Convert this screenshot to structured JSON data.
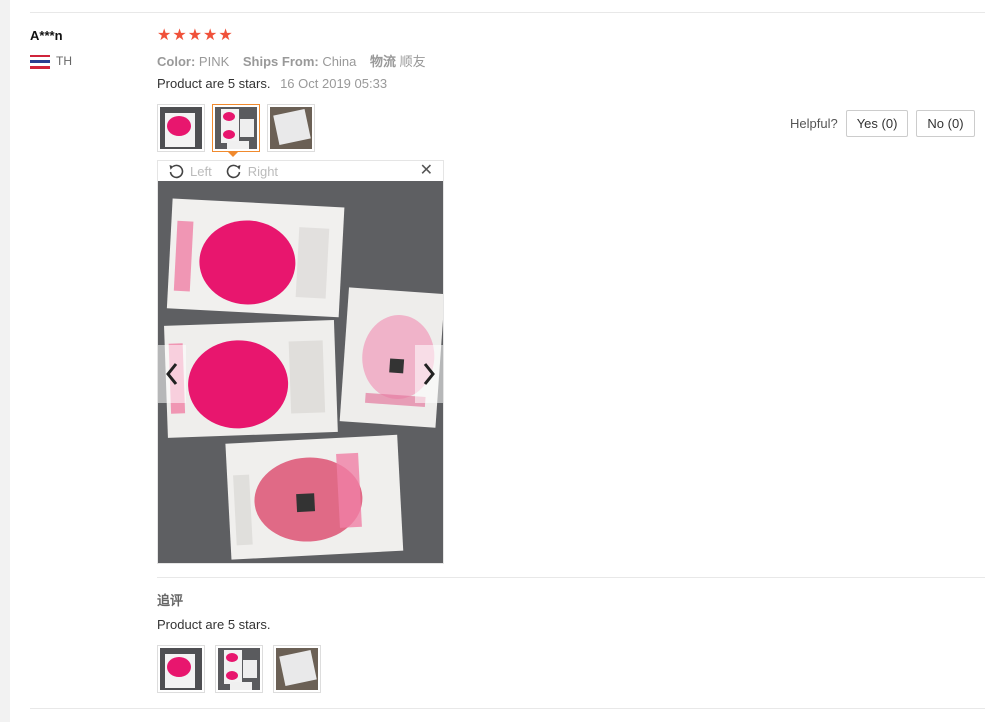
{
  "review": {
    "user_name": "A***n",
    "country_code": "TH",
    "rating": 5,
    "attributes": [
      {
        "key": "Color:",
        "value": "PINK"
      },
      {
        "key": "Ships From:",
        "value": "China"
      },
      {
        "key": "物流",
        "value": "顺友"
      }
    ],
    "comment": "Product are 5 stars.",
    "date": "16 Oct 2019 05:33",
    "thumbnails": [
      "pink-cleanser-photo",
      "boxes-photo",
      "white-package-photo"
    ],
    "active_thumbnail": 1
  },
  "viewer": {
    "rotate_left_label": "Left",
    "rotate_right_label": "Right"
  },
  "helpful": {
    "label": "Helpful?",
    "yes_label": "Yes (0)",
    "no_label": "No (0)"
  },
  "followup": {
    "title": "追评",
    "comment": "Product are 5 stars.",
    "thumbnails": [
      "pink-cleanser-photo",
      "boxes-photo",
      "white-package-photo"
    ]
  },
  "colors": {
    "star": "#f0513a",
    "accent": "#f08a2e",
    "product_pink": "#e8166e"
  }
}
